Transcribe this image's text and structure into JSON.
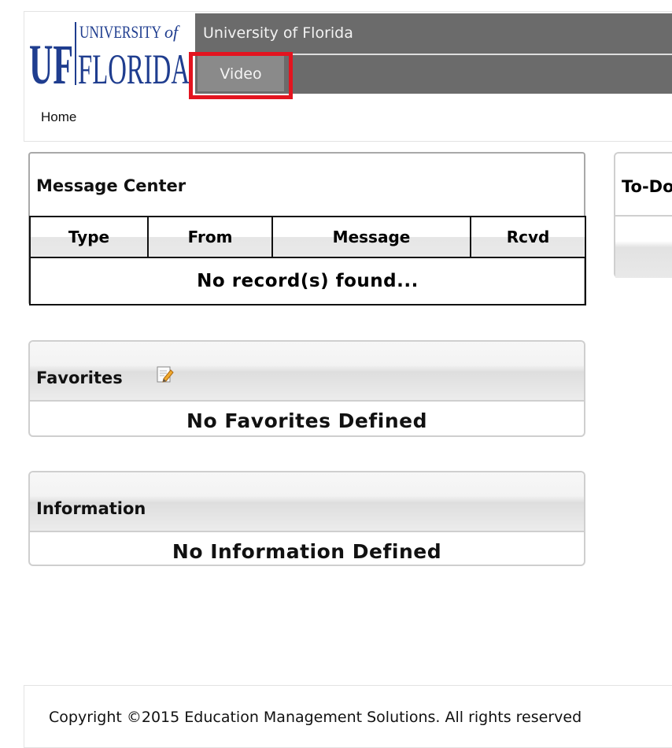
{
  "header": {
    "logo_alt": "UF UNIVERSITY of FLORIDA",
    "site_title": "University of Florida",
    "nav_tab": "Video"
  },
  "breadcrumb": "Home",
  "message_center": {
    "title": "Message Center",
    "columns": [
      "Type",
      "From",
      "Message",
      "Rcvd"
    ],
    "empty_text": "No record(s) found..."
  },
  "todo": {
    "title": "To-Do"
  },
  "favorites": {
    "title": "Favorites",
    "empty_text": "No Favorites Defined"
  },
  "information": {
    "title": "Information",
    "empty_text": "No Information Defined"
  },
  "footer": {
    "copyright": "Copyright ©2015 Education Management Solutions. All rights reserved"
  },
  "colors": {
    "uf_blue": "#1f3d8f",
    "header_gray": "#6b6b6b",
    "highlight_red": "#e3141f"
  },
  "icons": {
    "favorites_edit": "edit-note-icon"
  }
}
